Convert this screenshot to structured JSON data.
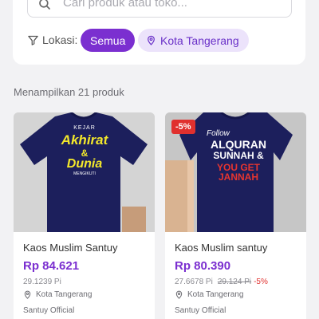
{
  "search": {
    "placeholder": "Cari produk atau toko..."
  },
  "filter": {
    "location_label": "Lokasi:",
    "chips": [
      "Semua",
      "Kota Tangerang"
    ],
    "active_chip": "Semua"
  },
  "result_count": "Menampilkan 21 produk",
  "colors": {
    "accent": "#7b2fd0",
    "chip_bg": "#ece3fb",
    "discount": "#e0302e",
    "shirt": "#1c1f5c"
  },
  "products": [
    {
      "name": "Kaos Muslim Santuy",
      "price": "Rp 84.621",
      "points": "29.1239 Pi",
      "location": "Kota Tangerang",
      "store": "Santuy Official",
      "print_lines": [
        "KEJAR",
        "Akhirat",
        "&",
        "Dunia",
        "MENGIKUTI"
      ]
    },
    {
      "name": "Kaos Muslim santuy",
      "price": "Rp 80.390",
      "points": "27.6678 Pi",
      "old_points": "29.124 Pi",
      "discount_pct": "-5%",
      "badge": "-5%",
      "location": "Kota Tangerang",
      "store": "Santuy Official",
      "print_lines": [
        "Follow",
        "ALQURAN",
        "SUNNAH &",
        "YOU GET",
        "JANNAH"
      ]
    }
  ]
}
